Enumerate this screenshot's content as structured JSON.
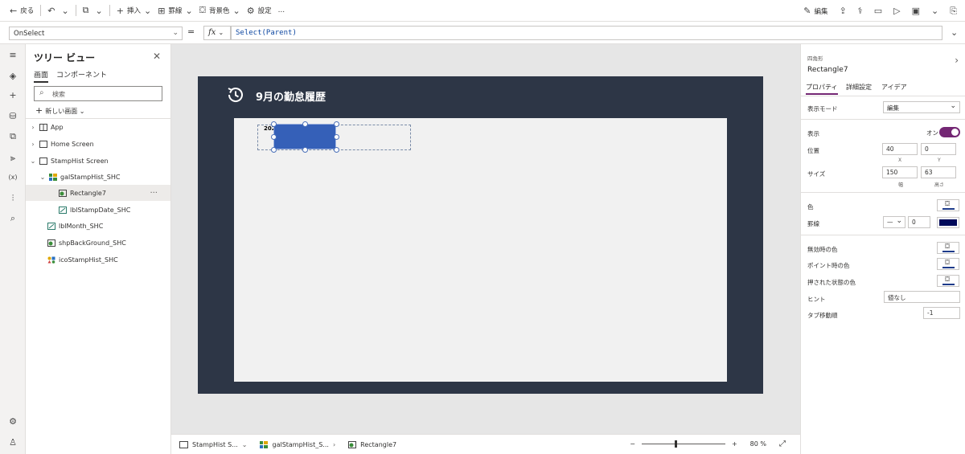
{
  "toolbar": {
    "back": "戻る",
    "insert": "挿入",
    "border": "罫線",
    "bg_color": "背景色",
    "settings": "設定",
    "more": "…",
    "edit": "編集"
  },
  "formula_bar": {
    "property": "OnSelect",
    "equals": "=",
    "fx": "fx",
    "formula": "Select(Parent)"
  },
  "tree": {
    "title": "ツリー ビュー",
    "tabs": [
      "画面",
      "コンポーネント"
    ],
    "search_placeholder": "検索",
    "new_screen": "新しい画面",
    "nodes": [
      {
        "label": "App"
      },
      {
        "label": "Home Screen"
      },
      {
        "label": "StampHist Screen"
      },
      {
        "label": "galStampHist_SHC"
      },
      {
        "label": "Rectangle7"
      },
      {
        "label": "lblStampDate_SHC"
      },
      {
        "label": "lblMonth_SHC"
      },
      {
        "label": "shpBackGround_SHC"
      },
      {
        "label": "icoStampHist_SHC"
      }
    ]
  },
  "canvas": {
    "screen_title": "9月の勤怠履歴",
    "date_label": "202"
  },
  "statusbar": {
    "crumbs": [
      "StampHist S...",
      "galStampHist_S...",
      "Rectangle7"
    ],
    "zoom_minus": "−",
    "zoom_plus": "+",
    "zoom_value": "80 %",
    "zoom_level": 80
  },
  "properties": {
    "type": "四角形",
    "name": "Rectangle7",
    "tabs": [
      "プロパティ",
      "詳細設定",
      "アイデア"
    ],
    "display_mode_label": "表示モード",
    "display_mode_value": "編集",
    "visible_label": "表示",
    "visible_value": "オン",
    "position_label": "位置",
    "x": "40",
    "y": "0",
    "x_cap": "X",
    "y_cap": "Y",
    "size_label": "サイズ",
    "width": "150",
    "height": "63",
    "width_cap": "幅",
    "height_cap": "高さ",
    "color_label": "色",
    "border_label": "罫線",
    "border_width": "0",
    "border_color": "#000a5a",
    "disabled_color_label": "無効時の色",
    "hover_color_label": "ポイント時の色",
    "pressed_color_label": "押された状態の色",
    "tooltip_label": "ヒント",
    "tooltip_value": "値なし",
    "tab_index_label": "タブ移動順",
    "tab_index_value": "-1"
  },
  "colors": {
    "screen_bg": "#2d3646",
    "rectangle_fill": "#3560b8",
    "accent": "#742774"
  }
}
